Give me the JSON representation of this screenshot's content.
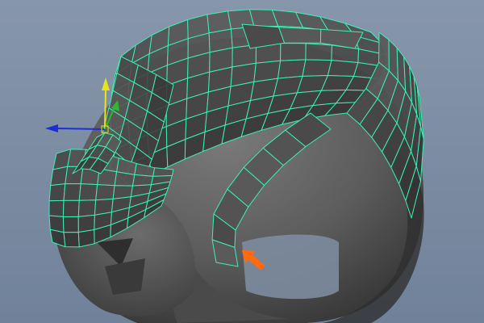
{
  "viewport": {
    "background_top": "#8796aa",
    "background_bottom": "#70829a"
  },
  "model": {
    "shell_color": "#5a5a5a",
    "shell_dark": "#3a3a3a",
    "shell_light": "#6e6e6e",
    "wireframe_color": "#3cf0b4",
    "selected_edge_color": "#6affc8"
  },
  "manipulator": {
    "icon": "move-manipulator-icon",
    "x_axis_color": "#1a2fd6",
    "y_axis_color": "#e8e21a",
    "z_axis_color": "#2fb82f"
  },
  "annotation": {
    "icon": "arrow-pointer-icon",
    "color": "#ff6a10"
  }
}
